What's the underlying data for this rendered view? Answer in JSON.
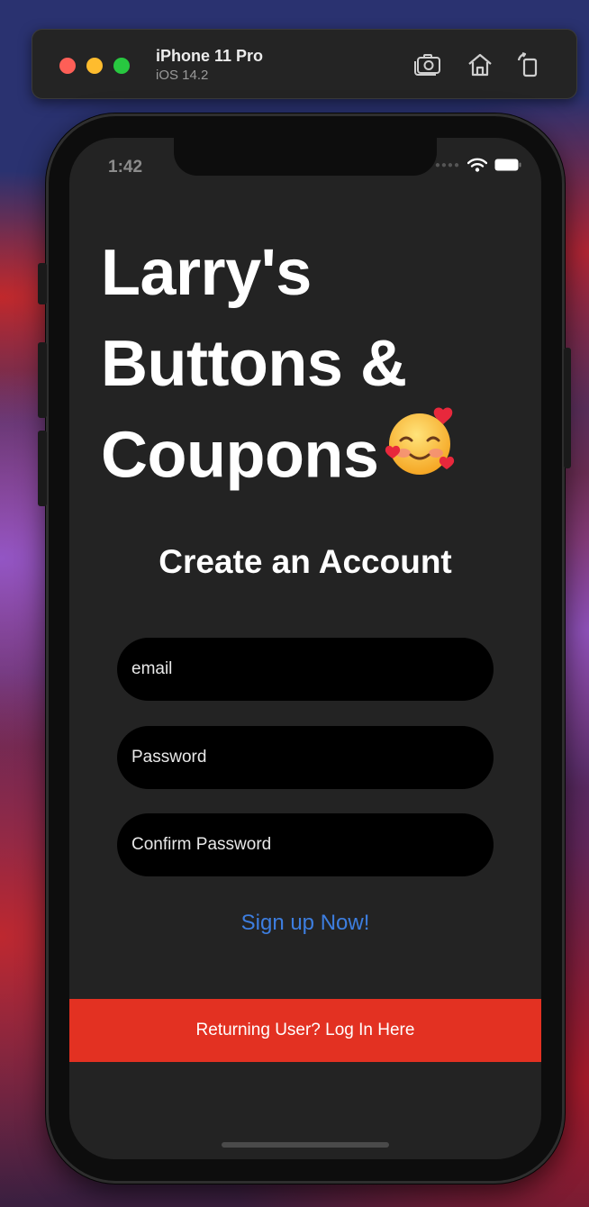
{
  "simulator": {
    "device_name": "iPhone 11 Pro",
    "os_version": "iOS 14.2",
    "icons": [
      "screenshot-icon",
      "home-icon",
      "rotate-icon"
    ]
  },
  "status_bar": {
    "time": "1:42",
    "icons": [
      "signal-icon",
      "wifi-icon",
      "battery-icon"
    ]
  },
  "hero": {
    "line1": "Larry's",
    "line2": "Buttons &",
    "line3": "Coupons",
    "emoji_icon": "smiling-face-with-hearts-icon"
  },
  "form": {
    "title": "Create an Account",
    "email_placeholder": "email",
    "password_placeholder": "Password",
    "confirm_placeholder": "Confirm Password",
    "signup_label": "Sign up Now!"
  },
  "login": {
    "label": "Returning User? Log In Here"
  },
  "colors": {
    "screen_bg": "#232323",
    "field_bg": "#000000",
    "link": "#3d7ee0",
    "login_bar": "#e33122"
  }
}
